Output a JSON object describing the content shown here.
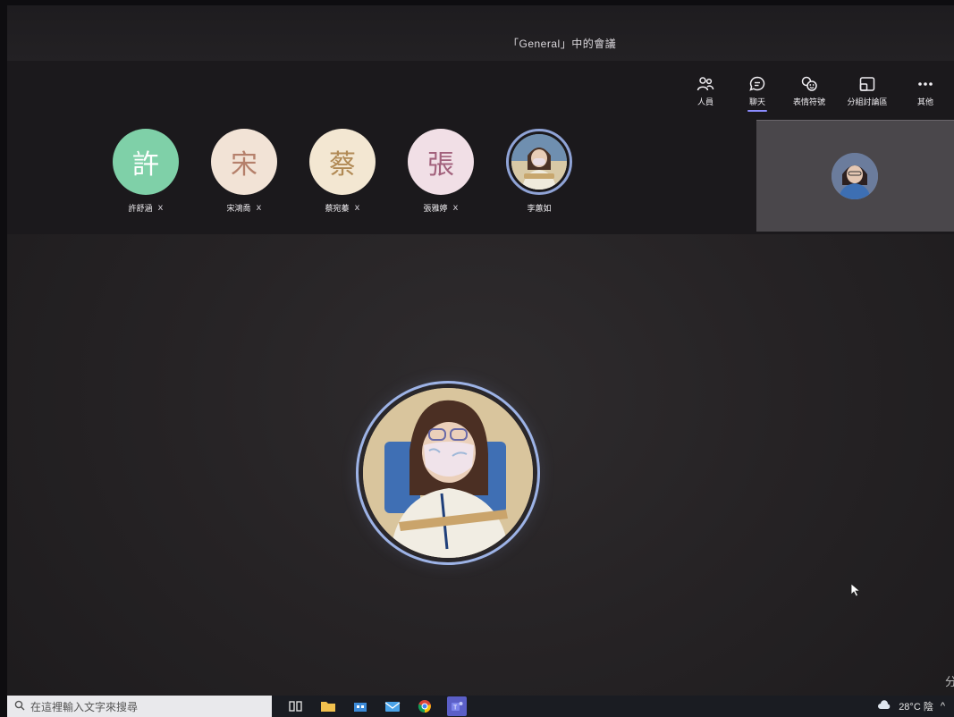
{
  "meeting": {
    "title": "「General」中的會議"
  },
  "toolbar": [
    {
      "id": "people",
      "label": "人員",
      "icon": "people-icon"
    },
    {
      "id": "chat",
      "label": "聊天",
      "icon": "chat-icon",
      "active": true
    },
    {
      "id": "reactions",
      "label": "表情符號",
      "icon": "reactions-icon"
    },
    {
      "id": "rooms",
      "label": "分組討論區",
      "icon": "breakout-rooms-icon"
    },
    {
      "id": "more",
      "label": "其他",
      "icon": "more-icon"
    }
  ],
  "participants": [
    {
      "initial": "許",
      "name": "許舒涵",
      "bg": "#7fd0a8",
      "fg": "#ffffff",
      "muted": true
    },
    {
      "initial": "宋",
      "name": "宋鴻喬",
      "bg": "#f2e3d6",
      "fg": "#b5806b",
      "muted": true
    },
    {
      "initial": "蔡",
      "name": "蔡宛蓁",
      "bg": "#f3e7d2",
      "fg": "#b18a55",
      "muted": true
    },
    {
      "initial": "張",
      "name": "張雅婷",
      "bg": "#f1dfe6",
      "fg": "#a2617c",
      "muted": true
    },
    {
      "initial": "",
      "name": "李蕙如",
      "photo": true,
      "muted": false
    }
  ],
  "taskbar": {
    "search_placeholder": "在這裡輸入文字來搜尋",
    "weather": "28°C 陰",
    "chevron": "^"
  },
  "edge_glyph": "分",
  "mic_off_glyph": "ⅹ"
}
